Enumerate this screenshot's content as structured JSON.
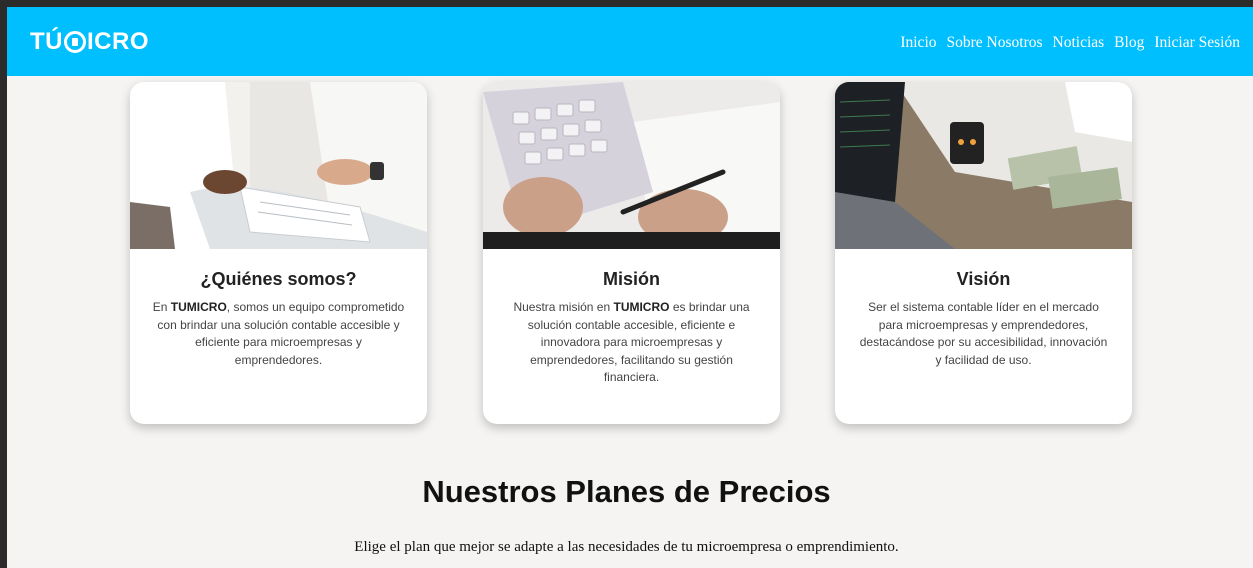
{
  "brand": {
    "logo_left": "TÚ",
    "logo_right": "ICRO",
    "color": "#00bfff"
  },
  "nav": {
    "items": [
      "Inicio",
      "Sobre Nosotros",
      "Noticias",
      "Blog",
      "Iniciar Sesión"
    ]
  },
  "cards": [
    {
      "title": "¿Quiénes somos?",
      "text_before": "En ",
      "text_bold": "TUMICRO",
      "text_after": ", somos un equipo comprometido con brindar una solución contable accesible y eficiente para microempresas y emprendedores.",
      "image": "business people reviewing documents"
    },
    {
      "title": "Misión",
      "text_before": "Nuestra misión en ",
      "text_bold": "TUMICRO",
      "text_after": " es brindar una solución contable accesible, eficiente e innovadora para microempresas y emprendedores, facilitando su gestión financiera.",
      "image": "calculator and pen on paper"
    },
    {
      "title": "Visión",
      "text_before": "Ser el sistema contable líder en el mercado para microempresas y emprendedores, destacándose por su accesibilidad, innovación y facilidad de uso.",
      "text_bold": "",
      "text_after": "",
      "image": "laptop, calculator and dollar bills"
    }
  ],
  "pricing": {
    "title": "Nuestros Planes de Precios",
    "subtitle": "Elige el plan que mejor se adapte a las necesidades de tu microempresa o emprendimiento."
  }
}
